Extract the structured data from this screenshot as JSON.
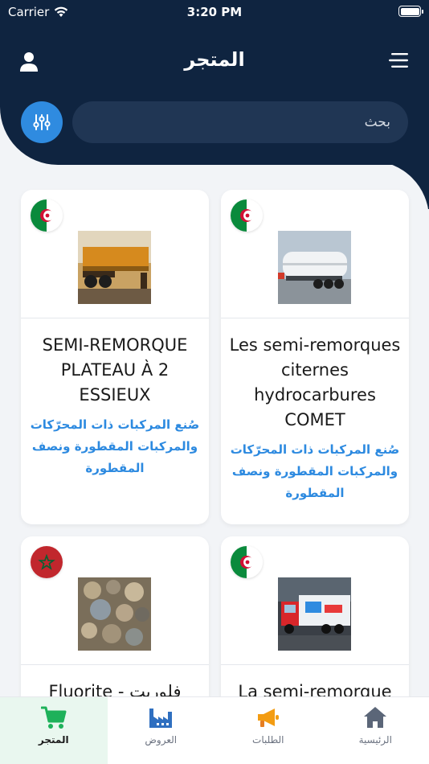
{
  "status_bar": {
    "carrier": "Carrier",
    "time": "3:20 PM"
  },
  "header": {
    "title": "المتجر"
  },
  "search": {
    "placeholder": "بحث"
  },
  "products": [
    {
      "title": "SEMI-REMORQUE PLATEAU À 2 ESSIEUX",
      "category": "صُنع المركبات ذات المحرّكات والمركبات المقطورة ونصف المقطورة",
      "flag": "algeria",
      "image_icon": "flatbed-trailer"
    },
    {
      "title": "Les semi-remorques citernes hydrocarbures COMET",
      "category": "صُنع المركبات ذات المحرّكات والمركبات المقطورة ونصف المقطورة",
      "flag": "algeria",
      "image_icon": "tanker-trailer"
    },
    {
      "title": "Fluorite - فلوريت",
      "category": "",
      "flag": "morocco",
      "image_icon": "fluorite-stones"
    },
    {
      "title": "La semi-remorque",
      "category": "",
      "flag": "algeria",
      "image_icon": "truck-trailer"
    }
  ],
  "tabs": [
    {
      "label": "المتجر",
      "icon": "cart-icon",
      "active": true
    },
    {
      "label": "العروض",
      "icon": "factory-icon",
      "active": false
    },
    {
      "label": "الطلبات",
      "icon": "megaphone-icon",
      "active": false
    },
    {
      "label": "الرئيسية",
      "icon": "home-icon",
      "active": false
    }
  ],
  "colors": {
    "header": "#0f2440",
    "accent": "#2f8be0",
    "active_tab": "#1eb15a"
  }
}
